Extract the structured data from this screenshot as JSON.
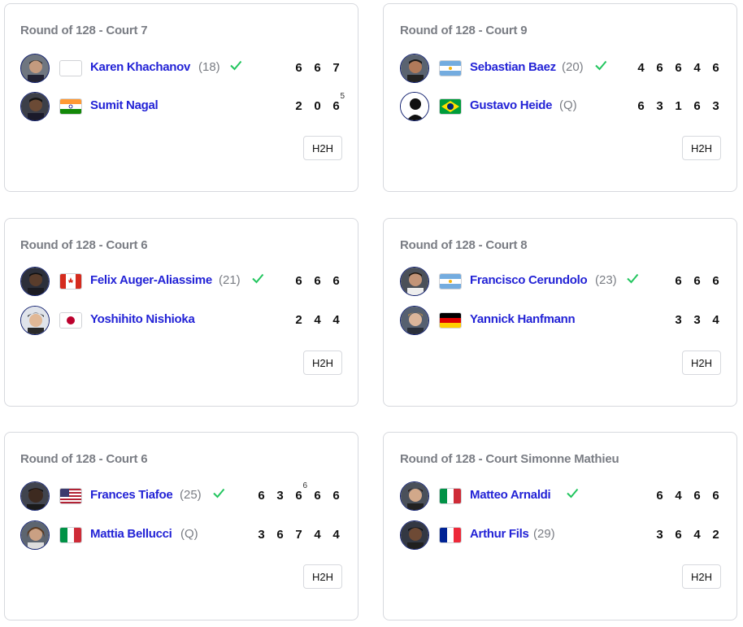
{
  "matches": [
    {
      "title": "Round of 128 - Court 7",
      "players": [
        {
          "name": "Karen Khachanov",
          "seed": "(18)",
          "winner": true,
          "scores": [
            "6",
            "6",
            "7"
          ],
          "tiebreaks": [
            "",
            "",
            ""
          ]
        },
        {
          "name": "Sumit Nagal",
          "seed": "",
          "winner": false,
          "scores": [
            "2",
            "0",
            "6"
          ],
          "tiebreaks": [
            "",
            "",
            "5"
          ]
        }
      ],
      "h2h": "H2H"
    },
    {
      "title": "Round of 128 - Court 9",
      "players": [
        {
          "name": "Sebastian Baez",
          "seed": "(20)",
          "winner": true,
          "scores": [
            "4",
            "6",
            "6",
            "4",
            "6"
          ],
          "tiebreaks": [
            "",
            "",
            "",
            "",
            ""
          ]
        },
        {
          "name": "Gustavo Heide",
          "seed": "(Q)",
          "winner": false,
          "scores": [
            "6",
            "3",
            "1",
            "6",
            "3"
          ],
          "tiebreaks": [
            "",
            "",
            "",
            "",
            ""
          ]
        }
      ],
      "h2h": "H2H"
    },
    {
      "title": "Round of 128 - Court 6",
      "players": [
        {
          "name": "Felix Auger-Aliassime",
          "seed": "(21)",
          "winner": true,
          "scores": [
            "6",
            "6",
            "6"
          ],
          "tiebreaks": [
            "",
            "",
            ""
          ]
        },
        {
          "name": "Yoshihito Nishioka",
          "seed": "",
          "winner": false,
          "scores": [
            "2",
            "4",
            "4"
          ],
          "tiebreaks": [
            "",
            "",
            ""
          ]
        }
      ],
      "h2h": "H2H"
    },
    {
      "title": "Round of 128 - Court 8",
      "players": [
        {
          "name": "Francisco Cerundolo",
          "seed": "(23)",
          "winner": true,
          "scores": [
            "6",
            "6",
            "6"
          ],
          "tiebreaks": [
            "",
            "",
            ""
          ]
        },
        {
          "name": "Yannick Hanfmann",
          "seed": "",
          "winner": false,
          "scores": [
            "3",
            "3",
            "4"
          ],
          "tiebreaks": [
            "",
            "",
            ""
          ]
        }
      ],
      "h2h": "H2H"
    },
    {
      "title": "Round of 128 - Court 6",
      "players": [
        {
          "name": "Frances Tiafoe",
          "seed": "(25)",
          "winner": true,
          "scores": [
            "6",
            "3",
            "6",
            "6",
            "6"
          ],
          "tiebreaks": [
            "",
            "",
            "6",
            "",
            ""
          ]
        },
        {
          "name": "Mattia Bellucci",
          "seed": "(Q)",
          "winner": false,
          "scores": [
            "3",
            "6",
            "7",
            "4",
            "4"
          ],
          "tiebreaks": [
            "",
            "",
            "",
            "",
            ""
          ]
        }
      ],
      "h2h": "H2H"
    },
    {
      "title": "Round of 128 - Court Simonne Mathieu",
      "players": [
        {
          "name": "Matteo Arnaldi",
          "seed": "",
          "winner": true,
          "scores": [
            "6",
            "4",
            "6",
            "6"
          ],
          "tiebreaks": [
            "",
            "",
            "",
            ""
          ]
        },
        {
          "name": "Arthur Fils",
          "seed": "(29)",
          "winner": false,
          "scores": [
            "3",
            "6",
            "4",
            "2"
          ],
          "tiebreaks": [
            "",
            "",
            "",
            ""
          ]
        }
      ],
      "h2h": "H2H"
    }
  ],
  "colors": {
    "player_name": "#2323d6",
    "title_gray": "#7a7d84",
    "check_green": "#22c55e",
    "avatar_border": "#0f1e6e"
  }
}
